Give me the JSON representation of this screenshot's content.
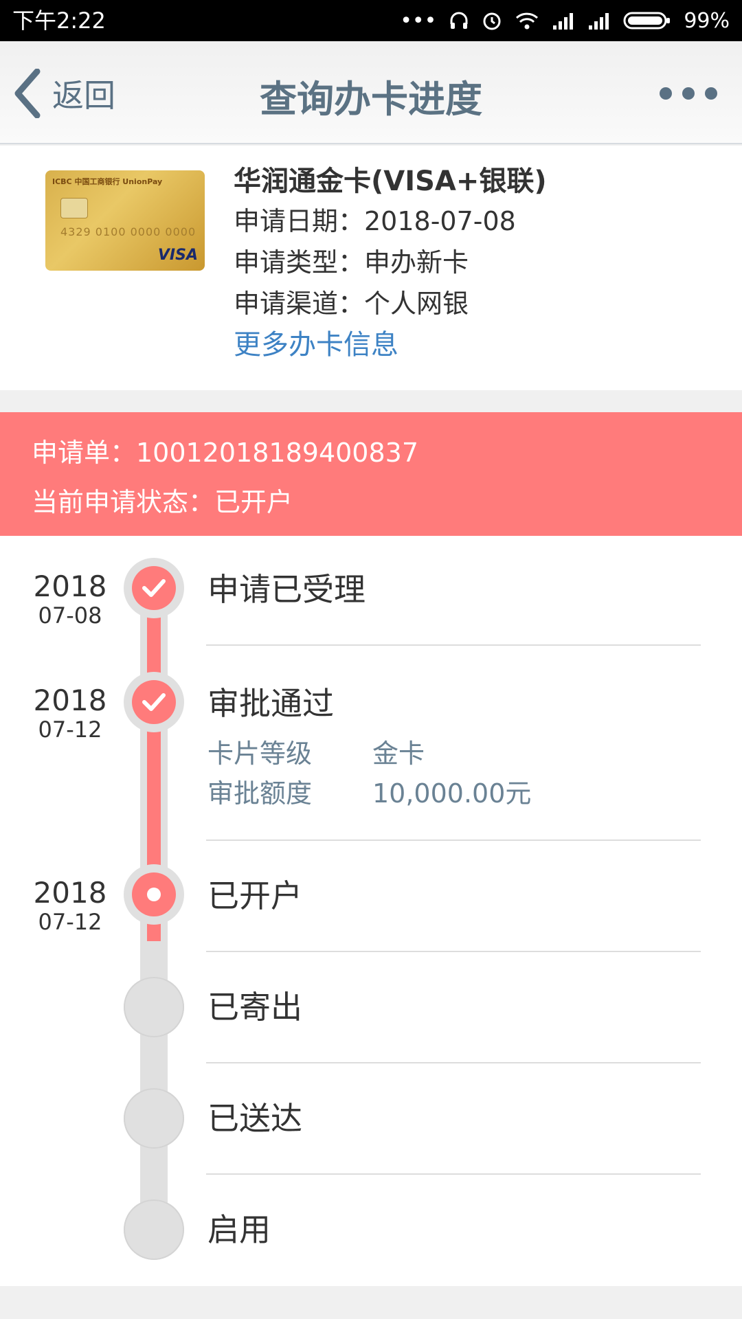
{
  "status_bar": {
    "time": "下午2:22",
    "battery": "99%",
    "dots": "•••"
  },
  "header": {
    "back_label": "返回",
    "title": "查询办卡进度"
  },
  "card": {
    "image_bank_text": "ICBC 中国工商银行 UnionPay",
    "image_number": "4329 0100 0000 0000",
    "image_brand": "VISA",
    "name": "华润通金卡(VISA+银联)",
    "apply_date": "申请日期：2018-07-08",
    "apply_type": "申请类型：申办新卡",
    "apply_channel": "申请渠道：个人网银",
    "more_link": "更多办卡信息"
  },
  "banner": {
    "application": "申请单：10012018189400837",
    "current_status": "当前申请状态：已开户",
    "color": "#ff7b7b"
  },
  "timeline": {
    "steps": [
      {
        "label": "申请已受理",
        "year": "2018",
        "date": "07-08",
        "state": "done"
      },
      {
        "label": "审批通过",
        "year": "2018",
        "date": "07-12",
        "state": "done",
        "details": [
          {
            "key": "卡片等级",
            "value": "金卡"
          },
          {
            "key": "审批额度",
            "value": "10,000.00元"
          }
        ]
      },
      {
        "label": "已开户",
        "year": "2018",
        "date": "07-12",
        "state": "current"
      },
      {
        "label": "已寄出",
        "year": "",
        "date": "",
        "state": "pending"
      },
      {
        "label": "已送达",
        "year": "",
        "date": "",
        "state": "pending"
      },
      {
        "label": "启用",
        "year": "",
        "date": "",
        "state": "pending"
      }
    ]
  }
}
